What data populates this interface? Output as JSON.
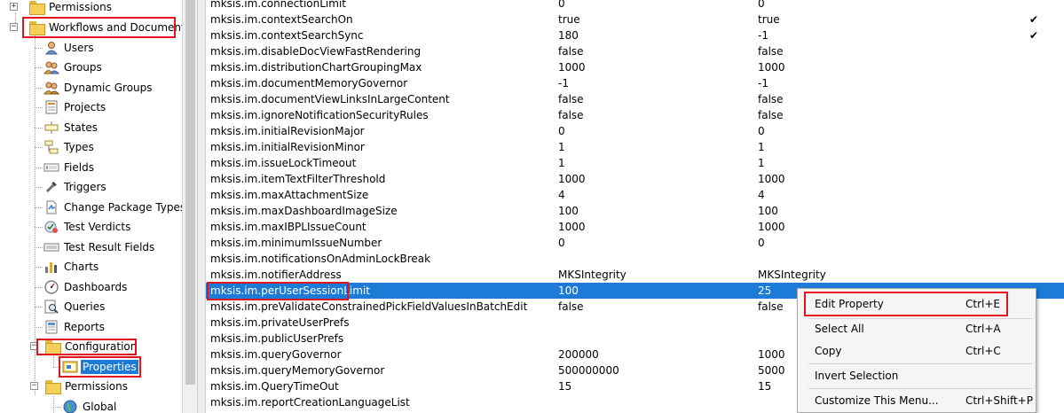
{
  "tree": {
    "items": [
      {
        "label": "Permissions",
        "icon": "folder-icon"
      },
      {
        "label": "Workflows and Documents",
        "icon": "folder-icon"
      },
      {
        "label": "Users",
        "icon": "user-icon"
      },
      {
        "label": "Groups",
        "icon": "group-icon"
      },
      {
        "label": "Dynamic Groups",
        "icon": "dynamic-group-icon"
      },
      {
        "label": "Projects",
        "icon": "projects-icon"
      },
      {
        "label": "States",
        "icon": "states-icon"
      },
      {
        "label": "Types",
        "icon": "types-icon"
      },
      {
        "label": "Fields",
        "icon": "fields-icon"
      },
      {
        "label": "Triggers",
        "icon": "triggers-icon"
      },
      {
        "label": "Change Package Types",
        "icon": "change-package-icon"
      },
      {
        "label": "Test Verdicts",
        "icon": "test-verdicts-icon"
      },
      {
        "label": "Test Result Fields",
        "icon": "test-result-fields-icon"
      },
      {
        "label": "Charts",
        "icon": "charts-icon"
      },
      {
        "label": "Dashboards",
        "icon": "dashboards-icon"
      },
      {
        "label": "Queries",
        "icon": "queries-icon"
      },
      {
        "label": "Reports",
        "icon": "reports-icon"
      },
      {
        "label": "Configuration",
        "icon": "folder-icon"
      },
      {
        "label": "Properties",
        "icon": "properties-icon"
      },
      {
        "label": "Permissions",
        "icon": "folder-icon"
      },
      {
        "label": "Global",
        "icon": "globe-icon"
      }
    ]
  },
  "properties": {
    "rows": [
      {
        "name": "mksis.im.connectionLimit",
        "value": "0",
        "default": "0",
        "check": ""
      },
      {
        "name": "mksis.im.contextSearchOn",
        "value": "true",
        "default": "true",
        "check": "✔"
      },
      {
        "name": "mksis.im.contextSearchSync",
        "value": "180",
        "default": "-1",
        "check": "✔"
      },
      {
        "name": "mksis.im.disableDocViewFastRendering",
        "value": "false",
        "default": "false",
        "check": ""
      },
      {
        "name": "mksis.im.distributionChartGroupingMax",
        "value": "1000",
        "default": "1000",
        "check": ""
      },
      {
        "name": "mksis.im.documentMemoryGovernor",
        "value": "-1",
        "default": "-1",
        "check": ""
      },
      {
        "name": "mksis.im.documentViewLinksInLargeContent",
        "value": "false",
        "default": "false",
        "check": ""
      },
      {
        "name": "mksis.im.ignoreNotificationSecurityRules",
        "value": "false",
        "default": "false",
        "check": ""
      },
      {
        "name": "mksis.im.initialRevisionMajor",
        "value": "0",
        "default": "0",
        "check": ""
      },
      {
        "name": "mksis.im.initialRevisionMinor",
        "value": "1",
        "default": "1",
        "check": ""
      },
      {
        "name": "mksis.im.issueLockTimeout",
        "value": "1",
        "default": "1",
        "check": ""
      },
      {
        "name": "mksis.im.itemTextFilterThreshold",
        "value": "1000",
        "default": "1000",
        "check": ""
      },
      {
        "name": "mksis.im.maxAttachmentSize",
        "value": "4",
        "default": "4",
        "check": ""
      },
      {
        "name": "mksis.im.maxDashboardImageSize",
        "value": "100",
        "default": "100",
        "check": ""
      },
      {
        "name": "mksis.im.maxIBPLIssueCount",
        "value": "1000",
        "default": "1000",
        "check": ""
      },
      {
        "name": "mksis.im.minimumIssueNumber",
        "value": "0",
        "default": "0",
        "check": ""
      },
      {
        "name": "mksis.im.notificationsOnAdminLockBreak",
        "value": "",
        "default": "",
        "check": ""
      },
      {
        "name": "mksis.im.notifierAddress",
        "value": "MKSIntegrity",
        "default": "MKSIntegrity",
        "check": ""
      },
      {
        "name": "mksis.im.perUserSessionLimit",
        "value": "100",
        "default": "25",
        "check": ""
      },
      {
        "name": "mksis.im.preValidateConstrainedPickFieldValuesInBatchEdit",
        "value": "false",
        "default": "false",
        "check": ""
      },
      {
        "name": "mksis.im.privateUserPrefs",
        "value": "",
        "default": "",
        "check": ""
      },
      {
        "name": "mksis.im.publicUserPrefs",
        "value": "",
        "default": "",
        "check": ""
      },
      {
        "name": "mksis.im.queryGovernor",
        "value": "200000",
        "default": "1000",
        "check": ""
      },
      {
        "name": "mksis.im.queryMemoryGovernor",
        "value": "500000000",
        "default": "5000",
        "check": ""
      },
      {
        "name": "mksis.im.QueryTimeOut",
        "value": "15",
        "default": "15",
        "check": ""
      },
      {
        "name": "mksis.im.reportCreationLanguageList",
        "value": "",
        "default": "",
        "check": ""
      }
    ]
  },
  "context_menu": {
    "items": [
      {
        "label": "Edit Property",
        "shortcut": "Ctrl+E"
      },
      {
        "label": "Select All",
        "shortcut": "Ctrl+A"
      },
      {
        "label": "Copy",
        "shortcut": "Ctrl+C"
      },
      {
        "label": "Invert Selection",
        "shortcut": ""
      },
      {
        "label": "Customize This Menu...",
        "shortcut": "Ctrl+Shift+P"
      }
    ]
  },
  "colors": {
    "selection": "#1c7bd6",
    "highlight_box": "#e0141c",
    "folder": "#f6cf5a"
  }
}
